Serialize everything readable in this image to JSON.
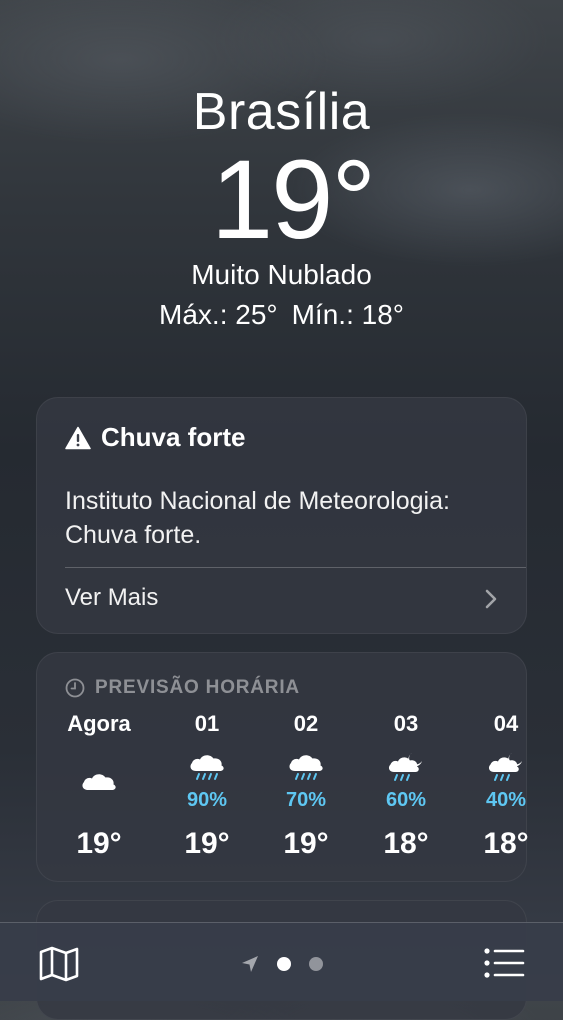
{
  "header": {
    "city": "Brasília",
    "temperature": "19°",
    "condition": "Muito Nublado",
    "high": "Máx.: 25°",
    "low": "Mín.: 18°"
  },
  "alert": {
    "icon": "warning-icon",
    "title": "Chuva forte",
    "body": "Instituto Nacional de Meteorologia: Chuva forte.",
    "more_label": "Ver Mais",
    "more_icon": "chevron-right-icon"
  },
  "hourly": {
    "icon": "clock-icon",
    "title": "PREVISÃO HORÁRIA",
    "precip_color": "#5ec7f2",
    "items": [
      {
        "time": "Agora",
        "icon": "cloud-icon",
        "precip": "",
        "temp": "19°"
      },
      {
        "time": "01",
        "icon": "cloud-rain-icon",
        "precip": "90%",
        "temp": "19°"
      },
      {
        "time": "02",
        "icon": "cloud-rain-icon",
        "precip": "70%",
        "temp": "19°"
      },
      {
        "time": "03",
        "icon": "cloud-moon-rain-icon",
        "precip": "60%",
        "temp": "18°"
      },
      {
        "time": "04",
        "icon": "cloud-moon-rain-icon",
        "precip": "40%",
        "temp": "18°"
      }
    ]
  },
  "tabbar": {
    "map_icon": "map-icon",
    "location_icon": "location-arrow-icon",
    "page_count": 2,
    "active_page": 1,
    "list_icon": "list-icon"
  }
}
